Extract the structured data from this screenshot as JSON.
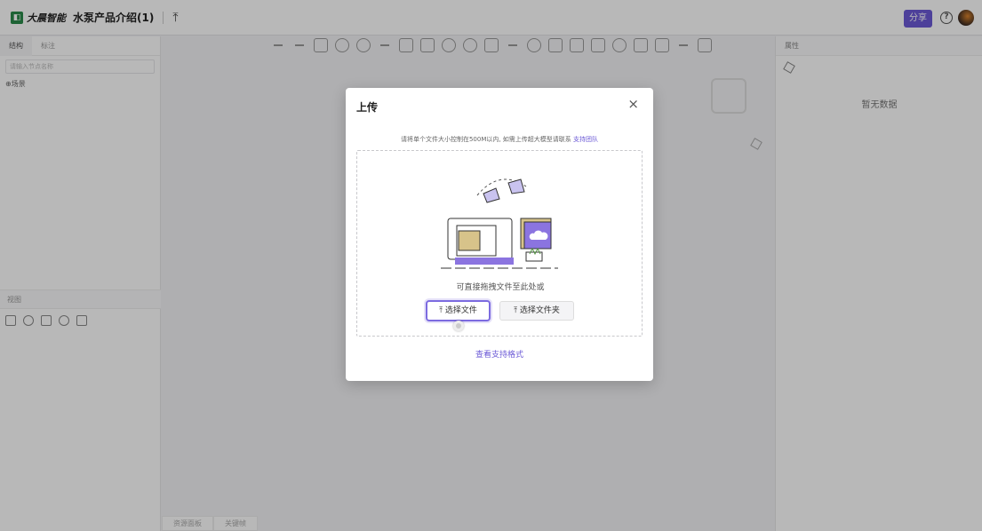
{
  "header": {
    "logo_text": "大晨智能",
    "doc_title": "水泵产品介绍(1)",
    "share_label": "分享",
    "help_label": "?"
  },
  "left_panel": {
    "tabs": [
      "结构",
      "标注"
    ],
    "search_placeholder": "请输入节点名称",
    "tree_root": "⊕场景",
    "view_header": "视图"
  },
  "right_panel": {
    "tab": "属性",
    "empty_text": "暂无数据"
  },
  "bottom_tabs": [
    "资源面板",
    "关键帧"
  ],
  "modal": {
    "title": "上传",
    "close": "×",
    "hint": "请将单个文件大小控制在500M以内, 如需上传超大模型请联系 ",
    "hint_link": "支持团队",
    "drop_text": "可直接拖拽文件至此处或",
    "select_file": "⤒ 选择文件",
    "select_folder": "⤒ 选择文件夹",
    "footer_link": "查看支持格式"
  },
  "colors": {
    "accent": "#6b59d6",
    "logo": "#2a8a4a"
  }
}
